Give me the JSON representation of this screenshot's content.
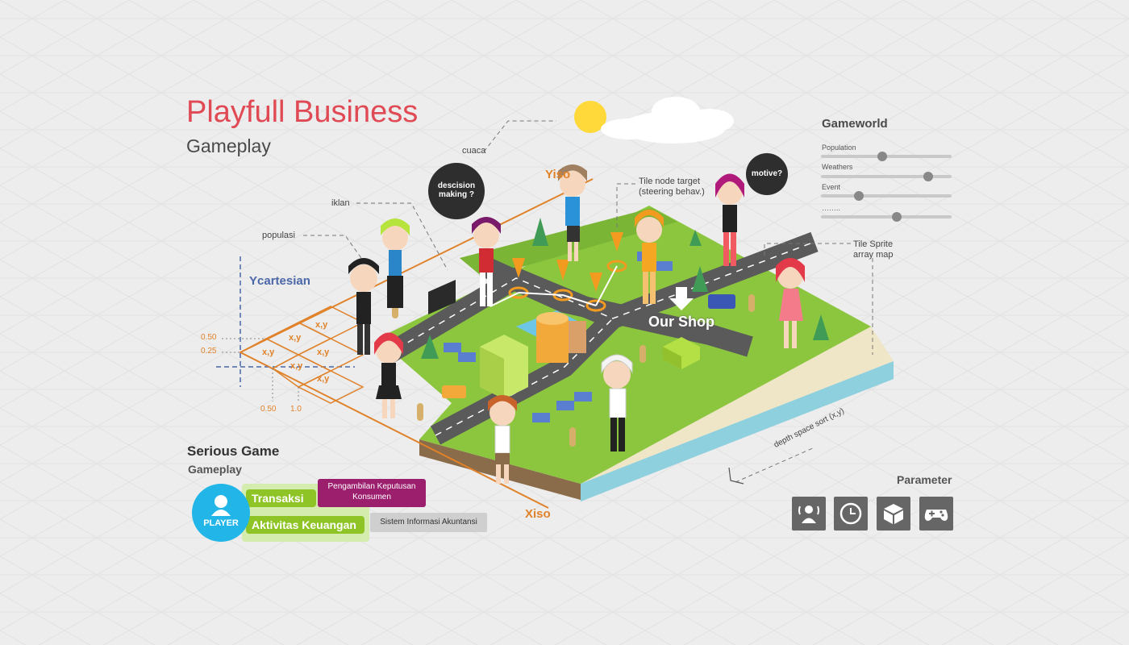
{
  "header": {
    "title": "Playfull Business",
    "subtitle": "Gameplay"
  },
  "annotations": {
    "cuaca": "cuaca",
    "iklan": "iklan",
    "populasi": "populasi",
    "tile_node_line1": "Tile node target",
    "tile_node_line2": "(steering behav.)",
    "tile_sprite_line1": "Tile Sprite",
    "tile_sprite_line2": "array map",
    "depth": "depth space sort (x,y)"
  },
  "bubbles": {
    "decision_line1": "descision",
    "decision_line2": "making ?",
    "motive": "motive?"
  },
  "axes": {
    "ycartesian": "Ycartesian",
    "yiso": "Yiso",
    "xiso": "Xiso",
    "ticks_y": [
      "0.50",
      "0.25"
    ],
    "ticks_x": [
      "0.50",
      "1.0"
    ],
    "cell_label": "x,y"
  },
  "shop_label": "Our Shop",
  "gameworld": {
    "title": "Gameworld",
    "sliders": [
      {
        "label": "Population",
        "value": 0.47
      },
      {
        "label": "Weathers",
        "value": 0.82
      },
      {
        "label": "Event",
        "value": 0.29
      },
      {
        "label": "……..",
        "value": 0.58
      }
    ]
  },
  "parameter": {
    "title": "Parameter",
    "icons": [
      "person-signal-icon",
      "clock-icon",
      "cube-icon",
      "gamepad-icon"
    ]
  },
  "serious_game": {
    "title": "Serious Game",
    "subtitle": "Gameplay",
    "player": "PLAYER",
    "transaksi": "Transaksi",
    "aktivitas": "Aktivitas Keuangan",
    "pengambilan_line1": "Pengambilan Keputusan",
    "pengambilan_line2": "Konsumen",
    "sistem": "Sistem Informasi Akuntansi"
  },
  "colors": {
    "accent_red": "#e04a54",
    "iso_orange": "#e0822a",
    "cartesian_blue": "#4a67a8",
    "green": "#8fc427",
    "purple": "#9c1f6e",
    "cyan": "#22b6e8"
  }
}
